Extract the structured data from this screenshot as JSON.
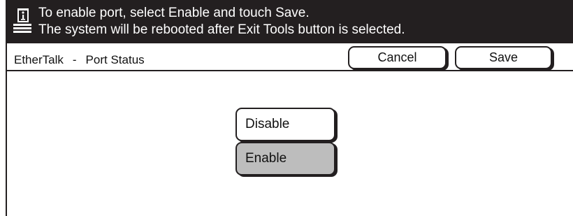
{
  "message": {
    "icon": "info-document-icon",
    "line1": "To enable port, select Enable and touch Save.",
    "line2": "The system will be rebooted after Exit Tools button is selected."
  },
  "header": {
    "section": "EtherTalk",
    "separator": "-",
    "page": "Port Status",
    "cancel_label": "Cancel",
    "save_label": "Save"
  },
  "options": {
    "disable_label": "Disable",
    "enable_label": "Enable",
    "selected": "Enable"
  },
  "colors": {
    "message_bar": "#231f20",
    "selected_option": "#bdbdbd"
  }
}
